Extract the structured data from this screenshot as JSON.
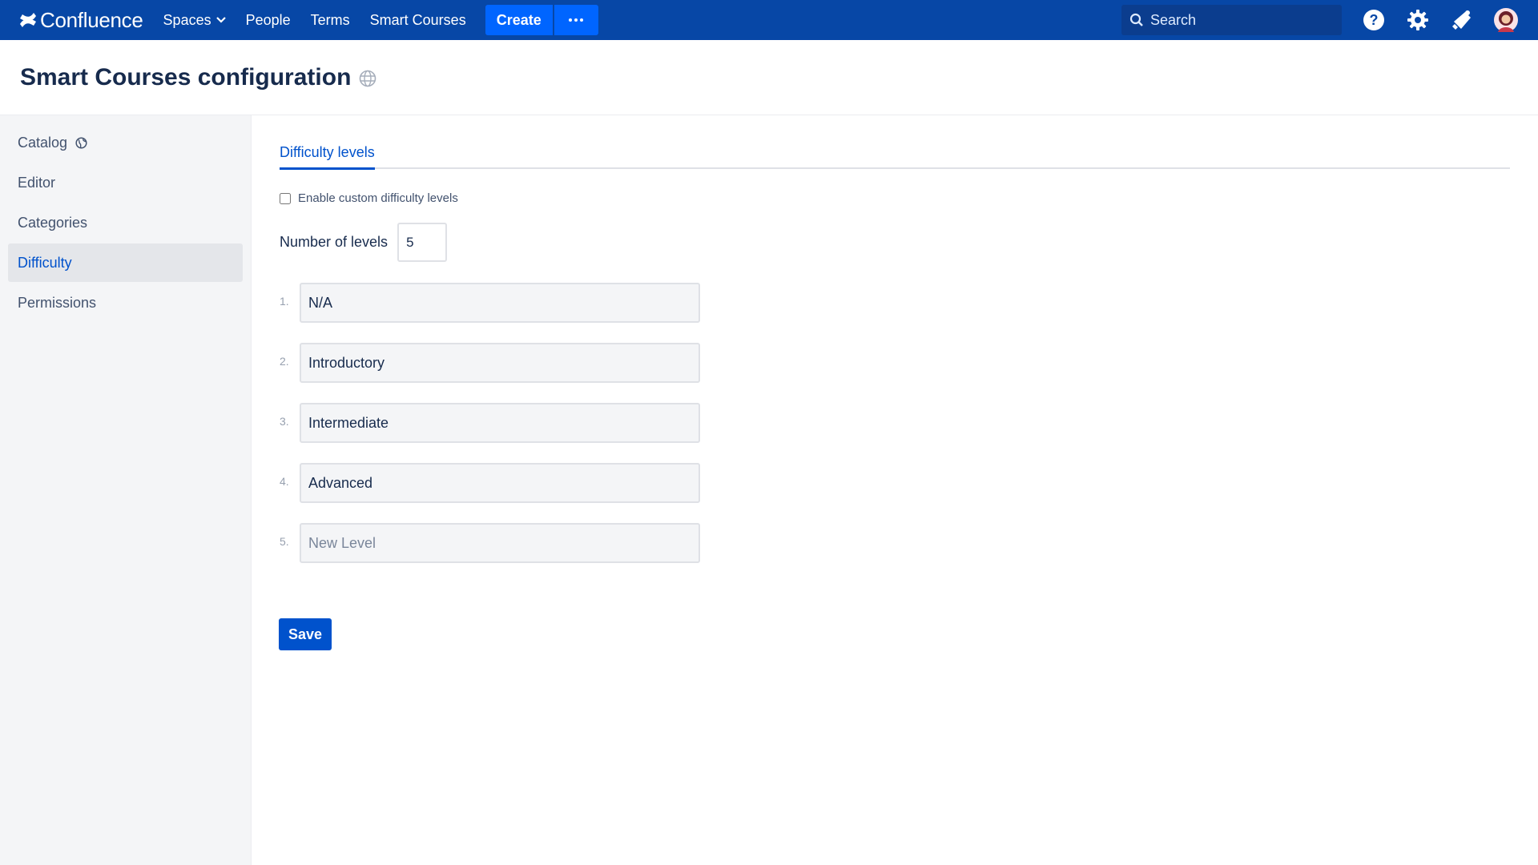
{
  "topbar": {
    "logo_text": "Confluence",
    "nav": [
      {
        "label": "Spaces"
      },
      {
        "label": "People"
      },
      {
        "label": "Terms"
      },
      {
        "label": "Smart Courses"
      }
    ],
    "create_label": "Create",
    "search_placeholder": "Search",
    "icons": [
      "help-icon",
      "settings-icon",
      "notifications-icon",
      "avatar"
    ]
  },
  "page": {
    "title": "Smart Courses configuration"
  },
  "sidebar": {
    "items": [
      {
        "label": "Catalog"
      },
      {
        "label": "Editor"
      },
      {
        "label": "Categories"
      },
      {
        "label": "Difficulty",
        "active": true
      },
      {
        "label": "Permissions"
      }
    ]
  },
  "main": {
    "tab_label": "Difficulty levels",
    "checkbox_label": "Enable custom difficulty levels",
    "checkbox_checked": false,
    "levels_label": "Number of levels",
    "levels_value": "5",
    "levels": [
      {
        "num": "1.",
        "value": "N/A",
        "placeholder": ""
      },
      {
        "num": "2.",
        "value": "Introductory",
        "placeholder": ""
      },
      {
        "num": "3.",
        "value": "Intermediate",
        "placeholder": ""
      },
      {
        "num": "4.",
        "value": "Advanced",
        "placeholder": ""
      },
      {
        "num": "5.",
        "value": "",
        "placeholder": "New Level"
      }
    ],
    "save_label": "Save"
  },
  "colors": {
    "brand": "#0747a6",
    "accent": "#0052cc",
    "create_button": "#0065ff"
  }
}
